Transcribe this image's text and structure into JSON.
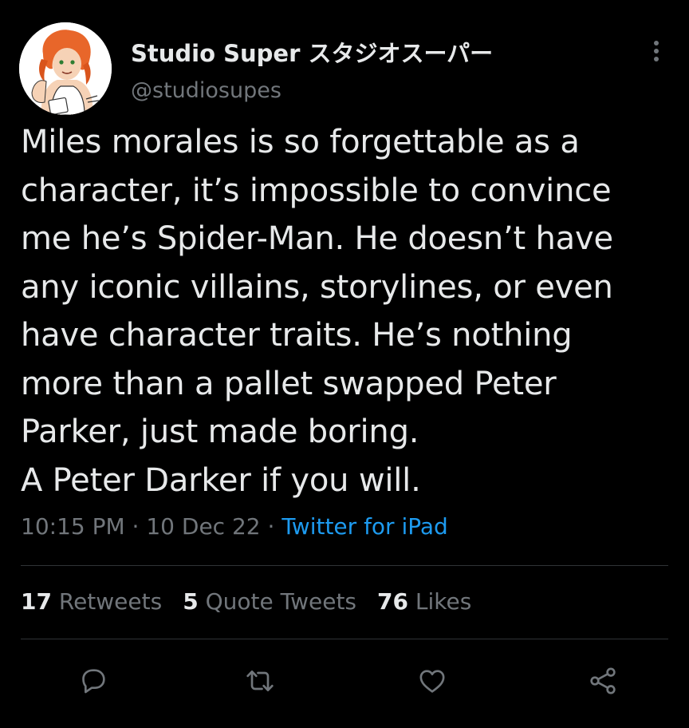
{
  "author": {
    "display_name": "Studio Super スタジオスーパー",
    "handle": "@studiosupes",
    "avatar_icon": "profile-avatar"
  },
  "tweet": {
    "text": "Miles morales is so forgettable as a\ncharacter, it’s impossible to convince\nme he’s Spider-Man. He doesn’t have\nany iconic villains, storylines, or even\nhave character traits. He’s nothing\nmore than a pallet swapped Peter\nParker, just made boring.\nA Peter Darker if you will.",
    "time": "10:15 PM",
    "separator": "·",
    "date": "10 Dec 22",
    "source": "Twitter for iPad"
  },
  "stats": {
    "retweets_count": "17",
    "retweets_label": "Retweets",
    "quotes_count": "5",
    "quotes_label": "Quote Tweets",
    "likes_count": "76",
    "likes_label": "Likes"
  },
  "actions": [
    {
      "icon": "reply-icon"
    },
    {
      "icon": "retweet-icon"
    },
    {
      "icon": "like-icon"
    },
    {
      "icon": "share-icon"
    }
  ],
  "colors": {
    "background": "#000000",
    "primary_text": "#e7e9ea",
    "secondary_text": "#71767b",
    "link": "#1d9bf0",
    "divider": "#2f3336"
  }
}
